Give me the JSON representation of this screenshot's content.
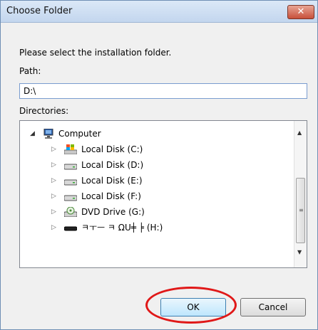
{
  "window": {
    "title": "Choose Folder",
    "close_label": "✕"
  },
  "instruction": "Please select the installation folder.",
  "path": {
    "label": "Path:",
    "value": "D:\\"
  },
  "directories": {
    "label": "Directories:",
    "items": [
      {
        "label": "Computer",
        "icon": "computer-icon"
      },
      {
        "label": "Local Disk (C:)",
        "icon": "system-drive-icon"
      },
      {
        "label": "Local Disk (D:)",
        "icon": "drive-icon"
      },
      {
        "label": "Local Disk (E:)",
        "icon": "drive-icon"
      },
      {
        "label": "Local Disk (F:)",
        "icon": "drive-icon"
      },
      {
        "label": "DVD Drive (G:)",
        "icon": "dvd-drive-icon"
      },
      {
        "label": "ㅋㅜㅡ ㅋ ΩU╪ ╞ (H:)",
        "icon": "removable-drive-icon"
      }
    ]
  },
  "buttons": {
    "ok": "OK",
    "cancel": "Cancel"
  },
  "colors": {
    "highlight_circle": "#e01818"
  }
}
